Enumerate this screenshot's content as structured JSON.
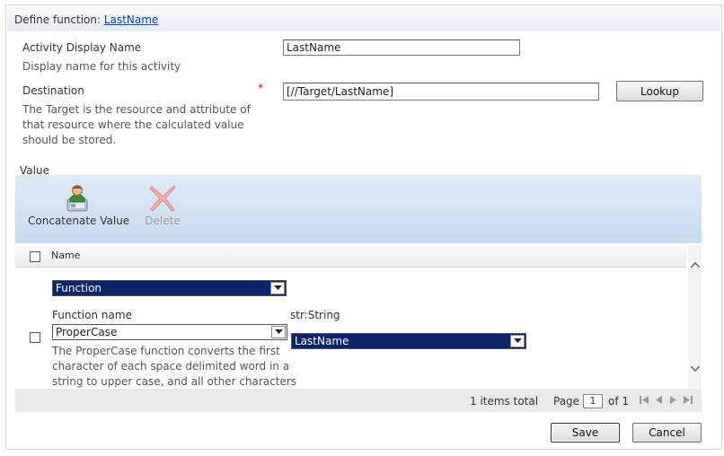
{
  "header": {
    "prefix": "Define function:",
    "link": "LastName"
  },
  "activity": {
    "label": "Activity Display Name",
    "desc": "Display name for this activity",
    "value": "LastName"
  },
  "destination": {
    "label": "Destination",
    "required": "*",
    "desc": [
      "The Target is the resource and attribute of",
      "that resource where the calculated value",
      "should be stored."
    ],
    "value": "[//Target/LastName]",
    "lookup": "Lookup"
  },
  "value_section": {
    "label": "Value",
    "toolbar": {
      "concat": "Concatenate Value",
      "delete": "Delete"
    },
    "grid": {
      "column": "Name",
      "row": {
        "type_select": "Function",
        "fn_label": "Function name",
        "fn_select": "ProperCase",
        "param_label": "str:String",
        "param_select": "LastName",
        "desc": [
          "The ProperCase function converts the first",
          "character of each space delimited word in a",
          "string to upper case, and all other characters"
        ]
      },
      "footer": {
        "total": "1 items total",
        "page_label": "Page",
        "page": "1",
        "of": "of 1"
      }
    }
  },
  "buttons": {
    "save": "Save",
    "cancel": "Cancel"
  }
}
